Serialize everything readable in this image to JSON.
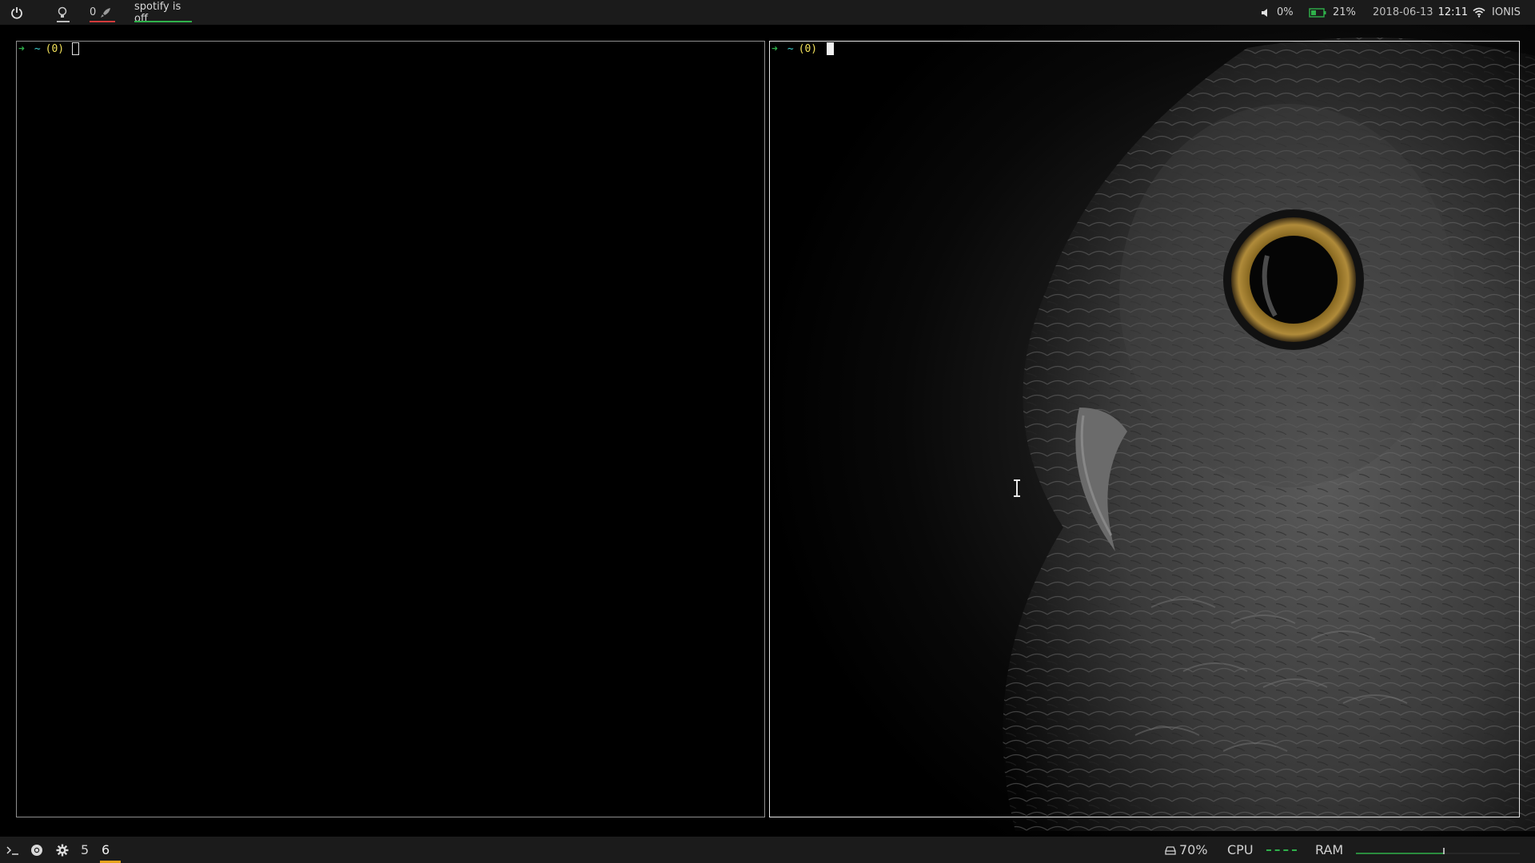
{
  "topbar": {
    "power_icon": "power-icon",
    "bulb_icon": "lightbulb-icon",
    "rocket_count": "0",
    "rocket_icon": "rocket-icon",
    "spotify_status": "spotify is off",
    "volume_icon": "speaker-icon",
    "volume": "0%",
    "battery_icon": "battery-icon",
    "battery": "21%",
    "date": "2018-06-13",
    "time": "12:11",
    "wifi_icon": "wifi-icon",
    "network": "IONIS",
    "colors": {
      "spotify_underline": "#2fb14b",
      "rocket_underline": "#d43b3b",
      "battery": "#2fb14b"
    }
  },
  "terminals": [
    {
      "prompt_arrow": "➜",
      "prompt_path": "~",
      "prompt_code": "(0)",
      "focused": false
    },
    {
      "prompt_arrow": "➜",
      "prompt_path": "~",
      "prompt_code": "(0)",
      "focused": true
    }
  ],
  "bottombar": {
    "terminal_icon": "terminal-icon",
    "chrome_icon": "chrome-icon",
    "settings_icon": "gear-icon",
    "workspaces": [
      "5",
      "6"
    ],
    "active_workspace": "6",
    "disk_icon": "disk-icon",
    "disk": "70%",
    "cpu_label": "CPU",
    "ram_label": "RAM",
    "colors": {
      "active_workspace": "#e5a31b",
      "graph": "#2fb14b"
    }
  }
}
